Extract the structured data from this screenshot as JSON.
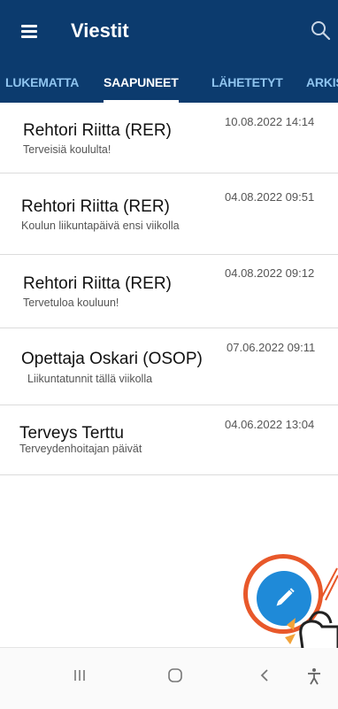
{
  "header": {
    "title": "Viestit",
    "menu_icon": "hamburger-menu-icon",
    "search_icon": "search-icon"
  },
  "tabs": [
    {
      "label": "LUKEMATTA",
      "active": false
    },
    {
      "label": "SAAPUNEET",
      "active": true
    },
    {
      "label": "LÄHETETYT",
      "active": false
    },
    {
      "label": "ARKIS",
      "active": false
    }
  ],
  "messages": [
    {
      "sender": "Rehtori Riitta (RER)",
      "preview": "Terveisiä koululta!",
      "date": "10.08.2022 14:14"
    },
    {
      "sender": "Rehtori Riitta (RER)",
      "preview": "Koulun liikuntapäivä ensi viikolla",
      "date": "04.08.2022 09:51"
    },
    {
      "sender": "Rehtori Riitta (RER)",
      "preview": "Tervetuloa kouluun!",
      "date": "04.08.2022 09:12"
    },
    {
      "sender": "Opettaja Oskari (OSOP)",
      "preview": "Liikuntatunnit tällä viikolla",
      "date": "07.06.2022 09:11"
    },
    {
      "sender": "Terveys Terttu",
      "preview": "Terveydenhoitajan päivät",
      "date": "04.06.2022 13:04"
    }
  ],
  "fab": {
    "icon": "pencil-icon",
    "color": "#1f8ad8"
  },
  "colors": {
    "header_bg": "#0c3b6e",
    "tab_inactive": "#8fc4ef",
    "highlight": "#e8582a"
  },
  "navbar": {
    "icons": [
      "recent-apps-icon",
      "home-icon",
      "back-icon",
      "accessibility-icon"
    ]
  }
}
